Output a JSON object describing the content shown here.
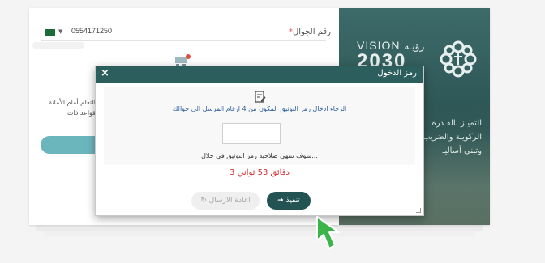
{
  "login_panel": {
    "vision_label": "VISION",
    "vision_arabic": "رؤيـة",
    "vision_year": "2030",
    "tagline": "التميـز بالقـدرة الركويـة والضريب وتبني أساليـ"
  },
  "form": {
    "phone_label": "رقم الجوال",
    "phone_required": "*",
    "phone_value": "0554171250",
    "side_text": "التعلم أمام الأمانة قواعد ذات"
  },
  "modal": {
    "title": "رمز الدخول",
    "close_symbol": "×",
    "instruction": "الرجاء ادخال رمز التوثيق المكون من 4 ارقام المرسل الى جوالك",
    "otp_value": "",
    "expire_text": "سوف تنتهي صلاحية رمز التوثيق في خلال...",
    "countdown": "3 دقائق 53 ثواني",
    "execute_label": "تنفيذ",
    "execute_icon": "arrow-left-icon",
    "resend_label": "اعادة الارسال",
    "resend_icon": "refresh-icon"
  },
  "colors": {
    "header": "#2c5e5d",
    "execute": "#235453",
    "countdown": "#d32f2f",
    "cursor": "#3bb54a"
  }
}
